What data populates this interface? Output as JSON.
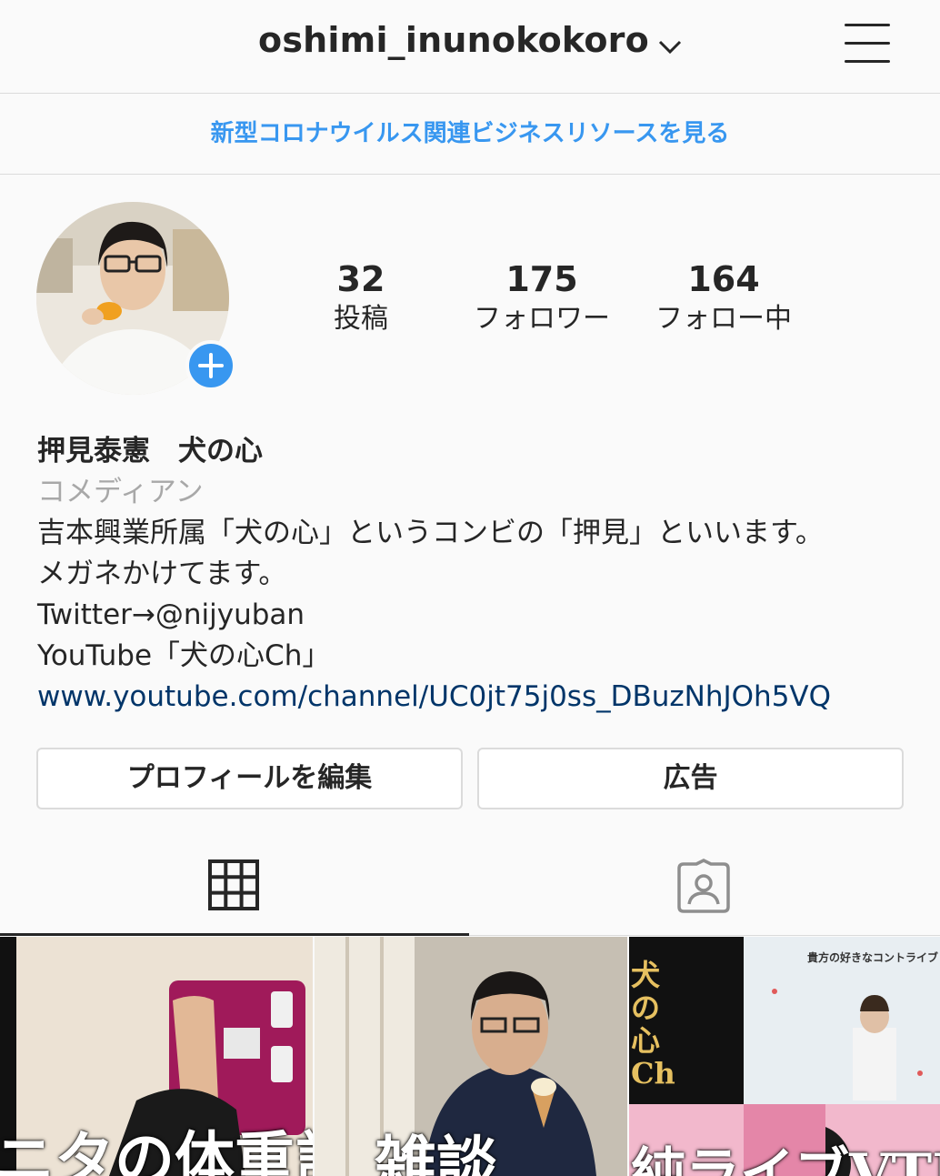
{
  "header": {
    "username": "oshimi_inunokokoro"
  },
  "banner": {
    "text": "新型コロナウイルス関連ビジネスリソースを見る"
  },
  "stats": [
    {
      "num": "32",
      "label": "投稿"
    },
    {
      "num": "175",
      "label": "フォロワー"
    },
    {
      "num": "164",
      "label": "フォロー中"
    }
  ],
  "bio": {
    "name": "押見泰憲　犬の心",
    "category": "コメディアン",
    "line1": "吉本興業所属「犬の心」というコンビの「押見」といいます。",
    "line2": "メガネかけてます。",
    "line3": "Twitter→@nijyuban",
    "line4": "YouTube「犬の心Ch」",
    "link": "www.youtube.com/channel/UC0jt75j0ss_DBuzNhJOh5VQ"
  },
  "buttons": {
    "edit_profile": "プロフィールを編集",
    "ads": "広告"
  },
  "posts": {
    "post1_caption": "ニタの体重計",
    "post2_caption": "雑談",
    "post3_side": "犬の心Ch",
    "post3_top": "貴方の好きなコントライブ",
    "post3_bottom": "純ライブVTR"
  },
  "colors": {
    "accent": "#3897f0",
    "link": "#003569",
    "border": "#dbdbdb"
  }
}
